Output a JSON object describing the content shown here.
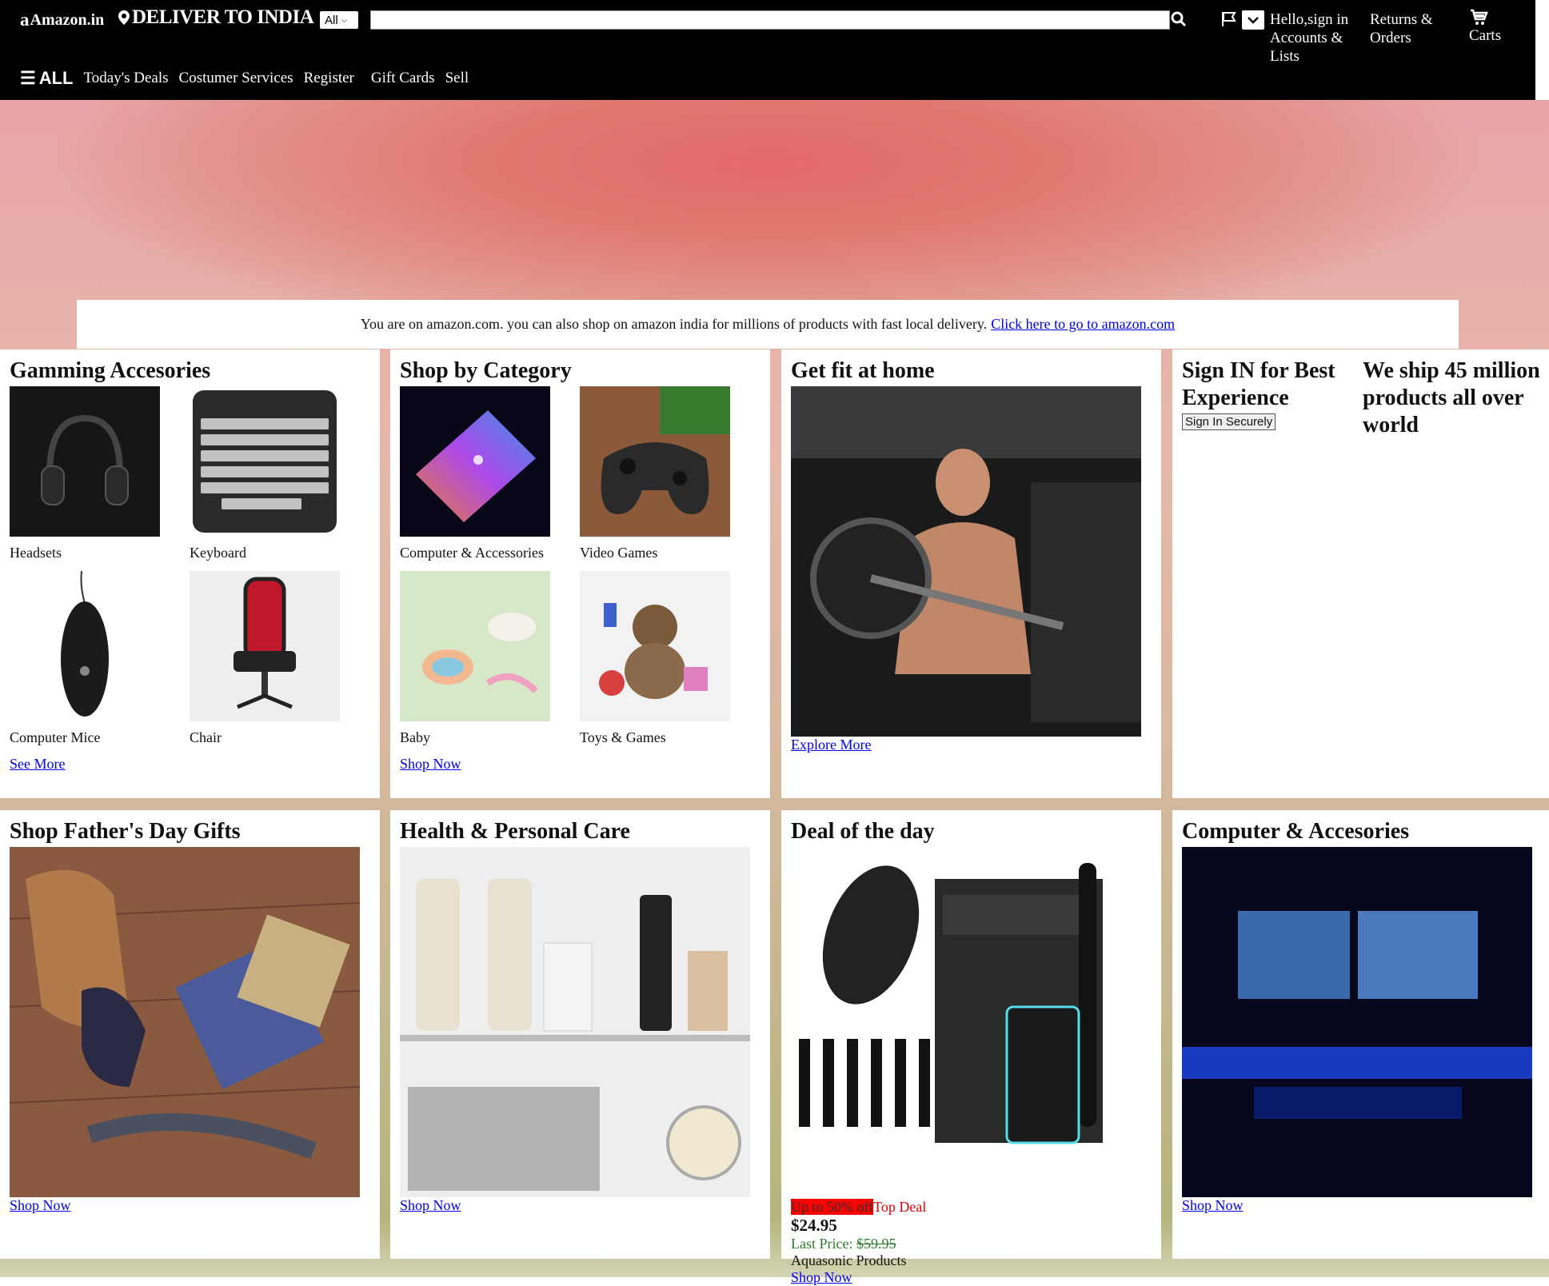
{
  "header": {
    "logo": "Amazon.in",
    "deliver": "DELIVER TO INDIA",
    "search_select": "All",
    "search_value": "",
    "hello": "Hello,sign in Accounts & Lists",
    "returns": "Returns & Orders",
    "cart": "Carts"
  },
  "subnav": {
    "all": "ALL",
    "items": [
      "Today's Deals",
      "Costumer Services",
      "Register",
      "Gift Cards",
      "Sell"
    ]
  },
  "notice": {
    "text": "You are on amazon.com. you can also shop on amazon india for millions of products with fast local delivery.",
    "link": "Click here to go to amazon.com"
  },
  "cards": {
    "gaming": {
      "title": "Gamming Accesories",
      "items": [
        "Headsets",
        "Keyboard",
        "Computer Mice",
        "Chair"
      ],
      "link": "See More"
    },
    "category": {
      "title": "Shop by Category",
      "items": [
        "Computer & Accessories",
        "Video Games",
        "Baby",
        "Toys & Games"
      ],
      "link": "Shop Now"
    },
    "fit": {
      "title": "Get fit at home",
      "link": "Explore More"
    },
    "signin": {
      "title": "Sign IN for Best Experience",
      "button": "Sign In Securely",
      "ship": "We ship 45 million products all over world"
    },
    "fathers": {
      "title": "Shop Father's Day Gifts",
      "link": "Shop Now"
    },
    "health": {
      "title": "Health & Personal Care",
      "link": "Shop Now"
    },
    "deal": {
      "title": "Deal of the day",
      "promo": "Up to 50% off",
      "top": "Top Deal",
      "price": "$24.95",
      "last_label": "Last Price:",
      "last_price": "$59.95",
      "brand": "Aquasonic Products",
      "link": "Shop Now"
    },
    "computer": {
      "title": "Computer & Accesories",
      "link": "Shop Now"
    }
  },
  "colors": {
    "header_bg": "#000000",
    "link": "#0000ee",
    "deal_red": "#ff0000",
    "last_green": "#2a7d2a"
  }
}
